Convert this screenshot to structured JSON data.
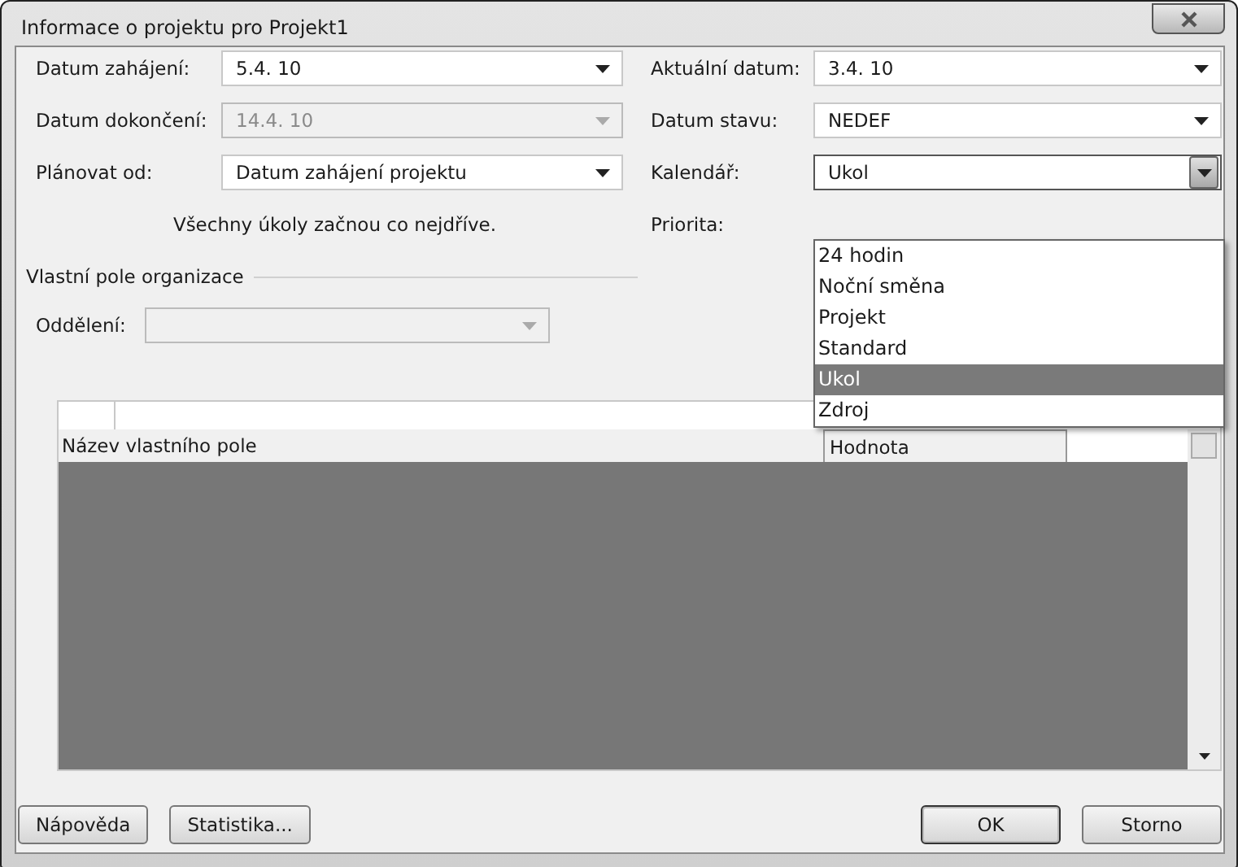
{
  "window": {
    "title": "Informace o projektu pro Projekt1"
  },
  "fields_left": [
    {
      "label": "Datum zahájení:",
      "value": "5.4. 10",
      "disabled": false
    },
    {
      "label": "Datum dokončení:",
      "value": "14.4. 10",
      "disabled": true
    },
    {
      "label": "Plánovat od:",
      "value": "Datum zahájení projektu",
      "disabled": false
    }
  ],
  "fields_right": [
    {
      "label": "Aktuální datum:",
      "value": "3.4. 10",
      "expanded": false
    },
    {
      "label": "Datum stavu:",
      "value": "NEDEF",
      "expanded": false
    },
    {
      "label": "Kalendář:",
      "value": "Ukol",
      "expanded": true
    }
  ],
  "schedule_note": "Všechny úkoly začnou co nejdříve.",
  "priority": {
    "label": "Priorita:"
  },
  "calendar_options": [
    {
      "label": "24 hodin",
      "selected": false
    },
    {
      "label": "Noční směna",
      "selected": false
    },
    {
      "label": "Projekt",
      "selected": false
    },
    {
      "label": "Standard",
      "selected": false
    },
    {
      "label": "Ukol",
      "selected": true
    },
    {
      "label": "Zdroj",
      "selected": false
    }
  ],
  "group": {
    "title": "Vlastní pole organizace",
    "department": {
      "label": "Oddělení:",
      "disabled": true
    }
  },
  "grid": {
    "columns": [
      "Název vlastního pole",
      "Hodnota"
    ]
  },
  "buttons_left": [
    {
      "label": "Nápověda",
      "default": false
    },
    {
      "label": "Statistika...",
      "default": false
    }
  ],
  "buttons_right": [
    {
      "label": "OK",
      "default": true
    },
    {
      "label": "Storno",
      "default": false
    }
  ]
}
